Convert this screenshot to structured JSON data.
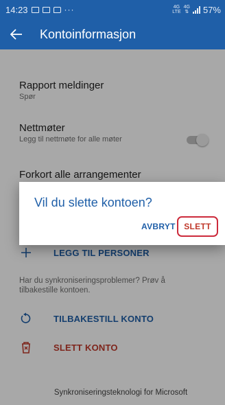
{
  "status_bar": {
    "time": "14:23",
    "dots": "···",
    "net1_top": "4G",
    "net1_bottom": "LTE",
    "net2_top": "4G",
    "battery": "57%"
  },
  "app_bar": {
    "title": "Kontoinformasjon"
  },
  "settings": {
    "report_messages": {
      "title": "Rapport meldinger",
      "subtitle": "Spør"
    },
    "online_meetings": {
      "title": "Nettmøter",
      "subtitle": "Legg til nettmøte for alle møter",
      "toggle_on": false
    },
    "shorten_events": {
      "title": "Forkort alle arrangementer"
    }
  },
  "actions": {
    "add_people": "LEGG TIL PERSONER",
    "help_text": "Har du synkroniseringsproblemer? Prøv å tilbakestille kontoen.",
    "reset_account": "TILBAKESTILL KONTO",
    "delete_account": "SLETT KONTO"
  },
  "footer": {
    "text": "Synkroniseringsteknologi for Microsoft"
  },
  "dialog": {
    "title": "Vil du slette kontoen?",
    "cancel_label": "AVBRYT",
    "delete_label": "SLETT"
  },
  "colors": {
    "primary": "#1f5fa8",
    "danger": "#c0392b",
    "highlight": "#cc2a3b"
  }
}
